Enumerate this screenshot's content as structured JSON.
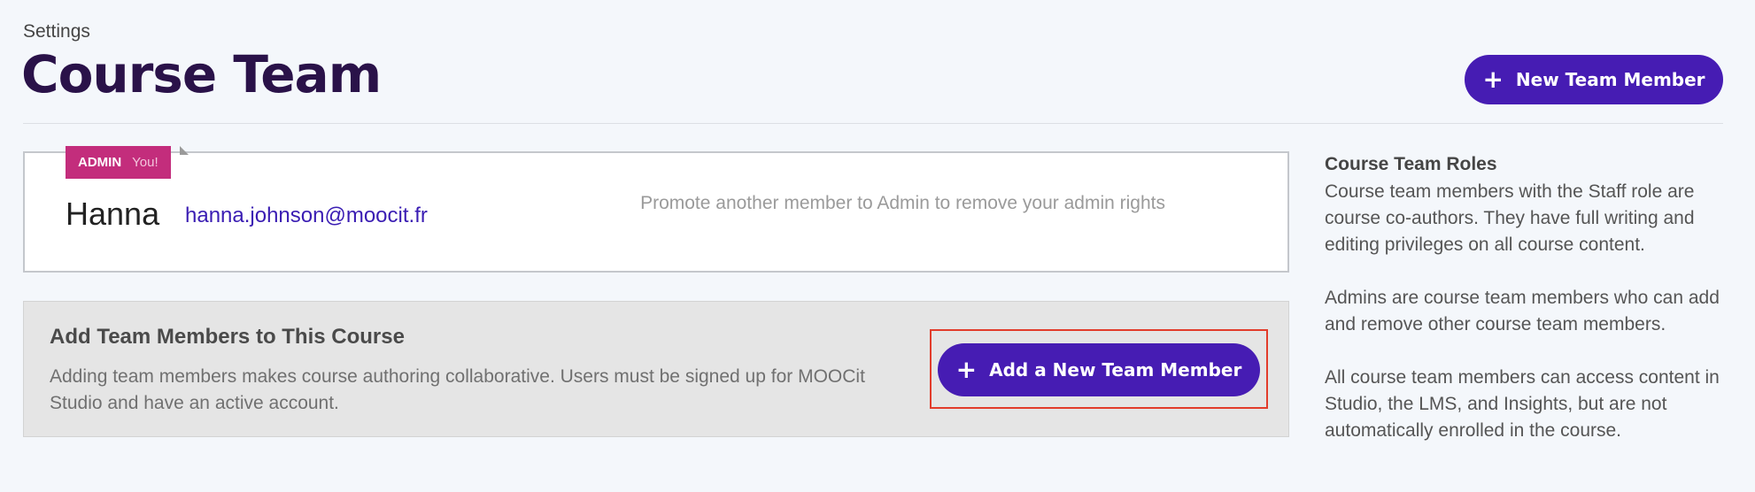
{
  "header": {
    "breadcrumb": "Settings",
    "title": "Course Team",
    "new_member_button": {
      "icon": "plus-icon",
      "label": "New Team Member"
    }
  },
  "members": [
    {
      "role_badge": "ADMIN",
      "you_label": "You!",
      "name": "Hanna",
      "email": "hanna.johnson@moocit.fr",
      "note": "Promote another member to Admin to remove your admin rights"
    }
  ],
  "add_panel": {
    "title": "Add Team Members to This Course",
    "description": "Adding team members makes course authoring collaborative. Users must be signed up for MOOCit Studio and have an active account.",
    "button": {
      "icon": "plus-icon",
      "label": "Add a New Team Member"
    }
  },
  "sidebar": {
    "title": "Course Team Roles",
    "paragraphs": [
      "Course team members with the Staff role are course co-authors. They have full writing and editing privileges on all course content.",
      "Admins are course team members who can add and remove other course team members.",
      "All course team members can access content in Studio, the LMS, and Insights, but are not automatically enrolled in the course."
    ]
  },
  "colors": {
    "primary": "#461cb3",
    "title": "#2a1249",
    "admin_badge": "#c32d7c",
    "highlight": "#e23c2b",
    "link": "#3a1db3"
  }
}
